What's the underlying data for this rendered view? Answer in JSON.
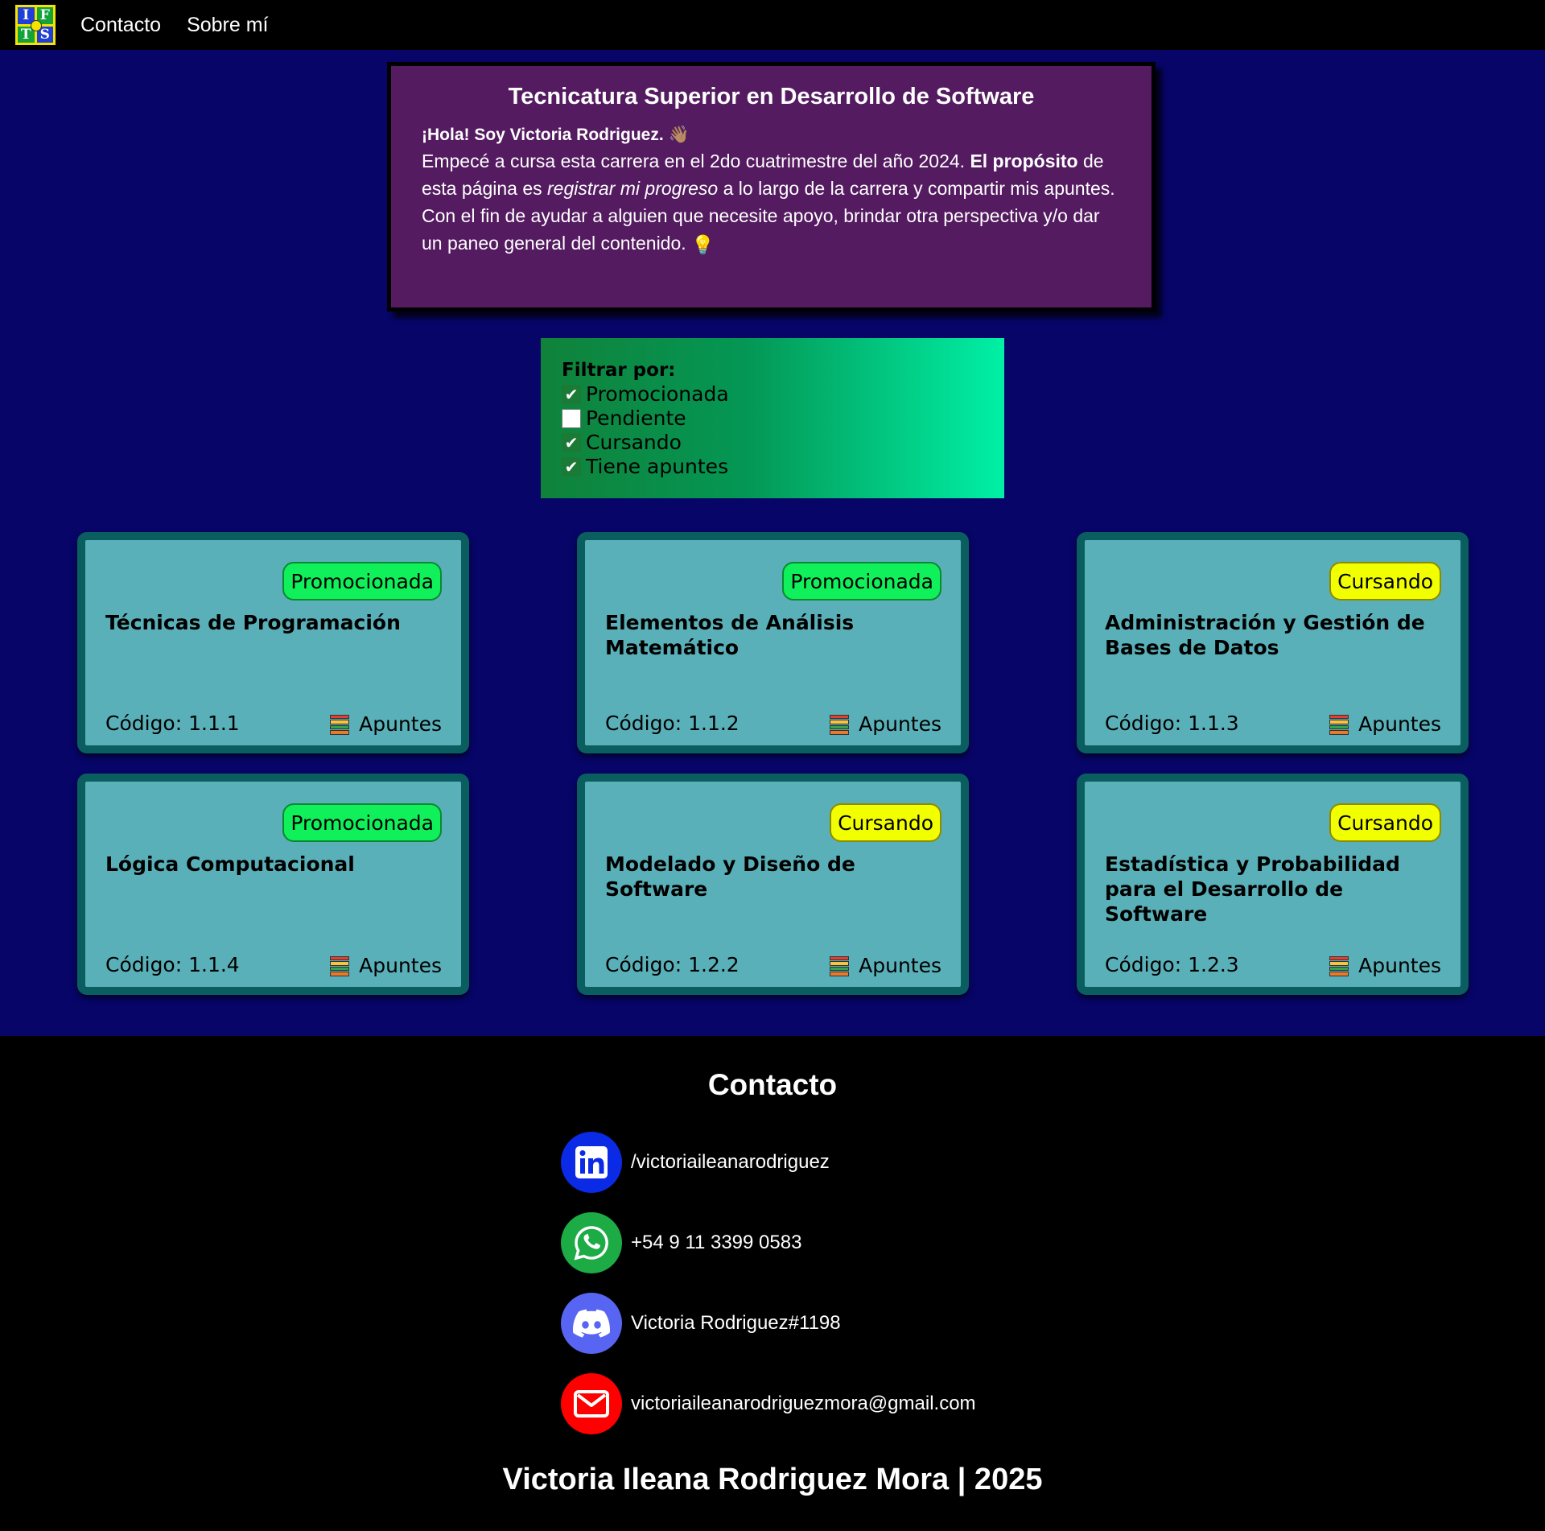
{
  "nav": {
    "logo_letters": [
      "I",
      "F",
      "T",
      "S"
    ],
    "links": [
      "Contacto",
      "Sobre mí"
    ]
  },
  "intro": {
    "title": "Tecnicatura Superior en Desarrollo de Software",
    "greeting": "¡Hola! Soy Victoria Rodriguez.",
    "p1_a": "Empecé a cursa esta carrera en el 2do cuatrimestre del año 2024.",
    "p1_b_bold": "El propósito",
    "p1_c": "de esta página es",
    "p1_d_italic": "registrar mi progreso",
    "p1_e": "a lo largo de la carrera y compartir mis apuntes.",
    "p2": "Con el fin de ayudar a alguien que necesite apoyo, brindar otra perspectiva y/o dar un paneo general del contenido.",
    "wave_emoji": "👋🏽",
    "bulb_emoji": "💡"
  },
  "filter": {
    "title": "Filtrar por:",
    "options": [
      {
        "label": "Promocionada",
        "checked": true
      },
      {
        "label": "Pendiente",
        "checked": false
      },
      {
        "label": "Cursando",
        "checked": true
      },
      {
        "label": "Tiene apuntes",
        "checked": true
      }
    ]
  },
  "cards": [
    {
      "status": "Promocionada",
      "title": "Técnicas de Programación",
      "code": "Código: 1.1.1",
      "notes": "Apuntes"
    },
    {
      "status": "Promocionada",
      "title": "Elementos de Análisis Matemático",
      "code": "Código: 1.1.2",
      "notes": "Apuntes"
    },
    {
      "status": "Cursando",
      "title": "Administración y Gestión de Bases de Datos",
      "code": "Código: 1.1.3",
      "notes": "Apuntes"
    },
    {
      "status": "Promocionada",
      "title": "Lógica Computacional",
      "code": "Código: 1.1.4",
      "notes": "Apuntes"
    },
    {
      "status": "Cursando",
      "title": "Modelado y Diseño de Software",
      "code": "Código: 1.2.2",
      "notes": "Apuntes"
    },
    {
      "status": "Cursando",
      "title": "Estadística y Probabilidad para el Desarrollo de Software",
      "code": "Código: 1.2.3",
      "notes": "Apuntes"
    }
  ],
  "footer": {
    "title": "Contacto",
    "contacts": [
      {
        "icon": "linkedin-icon",
        "text": "/victoriaileanarodriguez",
        "color": "#0a2ae6"
      },
      {
        "icon": "whatsapp-icon",
        "text": "+54 9 11 3399 0583",
        "color": "#1cab45"
      },
      {
        "icon": "discord-icon",
        "text": "Victoria Rodriguez#1198",
        "color": "#5865f2"
      },
      {
        "icon": "mail-icon",
        "text": "victoriaileanarodriguezmora@gmail.com",
        "color": "#ff0000"
      }
    ],
    "signature": "Victoria Ileana Rodriguez Mora | 2025"
  },
  "colors": {
    "page_bg": "#070568",
    "intro_bg": "#541b60",
    "card_bg": "#5ab0b8",
    "card_border": "#0a5e60",
    "badge_promocionada": "#10f05a",
    "badge_cursando": "#f2ff00"
  }
}
